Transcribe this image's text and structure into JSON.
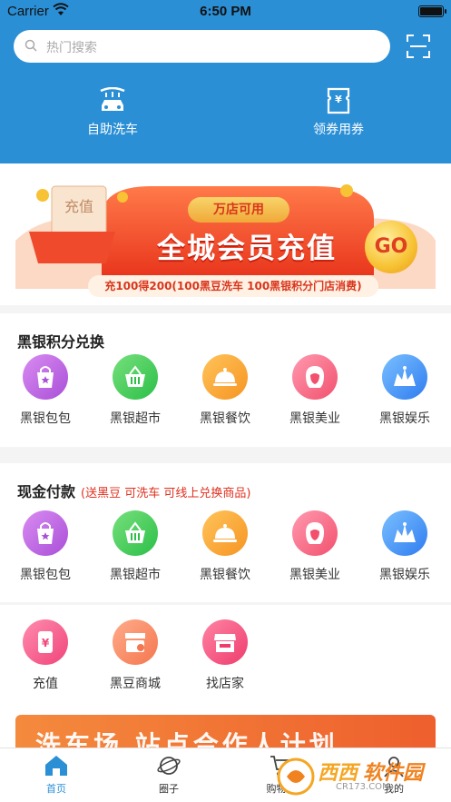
{
  "status_bar": {
    "carrier": "Carrier",
    "time": "6:50 PM"
  },
  "search": {
    "placeholder": "热门搜索"
  },
  "quick_actions": [
    {
      "label": "自助洗车",
      "icon": "car-wash-icon"
    },
    {
      "label": "领券用券",
      "icon": "coupon-icon"
    }
  ],
  "banner": {
    "tag": "万店可用",
    "headline": "全城会员充值",
    "card_text": "充值",
    "go_label": "GO",
    "strip_text": "充100得200(100黑豆洗车 100黑银积分门店消费)"
  },
  "points_section": {
    "title": "黑银积分兑换",
    "items": [
      {
        "label": "黑银包包",
        "icon": "bag-icon"
      },
      {
        "label": "黑银超市",
        "icon": "basket-icon"
      },
      {
        "label": "黑银餐饮",
        "icon": "food-cloche-icon"
      },
      {
        "label": "黑银美业",
        "icon": "beauty-icon"
      },
      {
        "label": "黑银娱乐",
        "icon": "crown-icon"
      }
    ]
  },
  "cash_section": {
    "title": "现金付款",
    "subtitle": "(送黑豆 可洗车 可线上兑换商品)",
    "items": [
      {
        "label": "黑银包包",
        "icon": "bag-icon"
      },
      {
        "label": "黑银超市",
        "icon": "basket-icon"
      },
      {
        "label": "黑银餐饮",
        "icon": "food-cloche-icon"
      },
      {
        "label": "黑银美业",
        "icon": "beauty-icon"
      },
      {
        "label": "黑银娱乐",
        "icon": "crown-icon"
      }
    ]
  },
  "services": [
    {
      "label": "充值",
      "icon": "phone-yen-icon"
    },
    {
      "label": "黑豆商城",
      "icon": "store-icon"
    },
    {
      "label": "找店家",
      "icon": "shop-front-icon"
    }
  ],
  "promo_banner": {
    "text": "洗车场 站点合作人计划"
  },
  "tabbar": [
    {
      "label": "首页",
      "icon": "home-icon",
      "active": true
    },
    {
      "label": "圈子",
      "icon": "planet-icon",
      "active": false
    },
    {
      "label": "购物车",
      "icon": "cart-icon",
      "active": false
    },
    {
      "label": "我的",
      "icon": "profile-icon",
      "active": false
    }
  ],
  "watermark": {
    "text_a": "西西",
    "text_b": "软件园",
    "domain": "CR173.COM"
  },
  "colors": {
    "header_blue": "#2b8fd6",
    "accent_red": "#e0301e",
    "tab_active": "#2b8fd6"
  }
}
